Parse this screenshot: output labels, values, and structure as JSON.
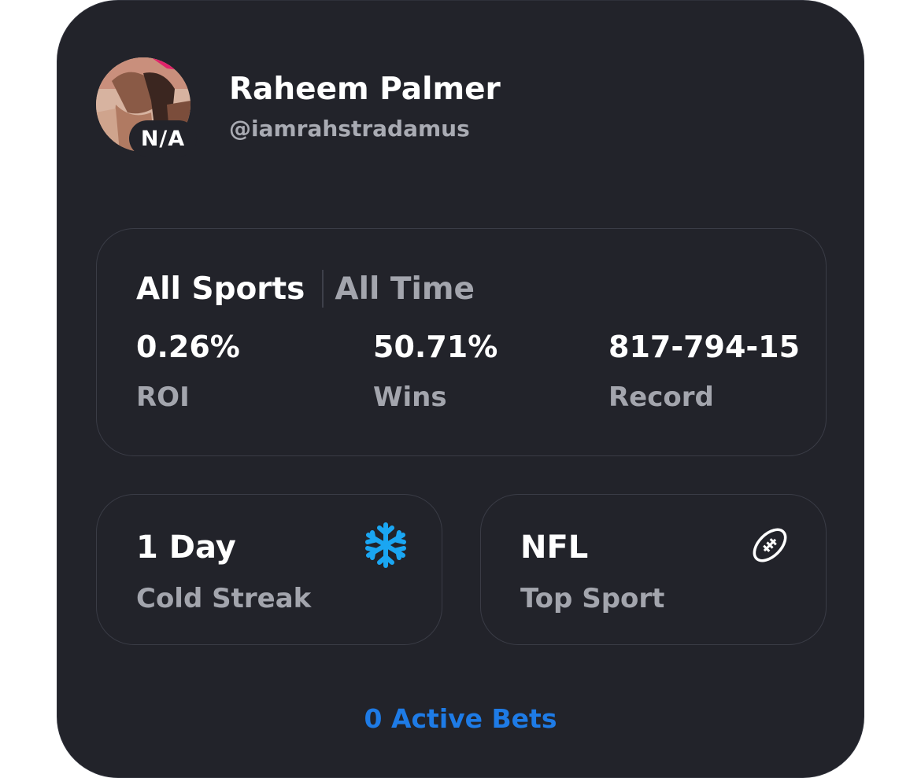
{
  "profile": {
    "name": "Raheem Palmer",
    "handle": "@iamrahstradamus",
    "rank_badge": "N/A"
  },
  "filters": {
    "sport": "All Sports",
    "time": "All Time"
  },
  "stats": {
    "roi": {
      "value": "0.26%",
      "label": "ROI"
    },
    "wins": {
      "value": "50.71%",
      "label": "Wins"
    },
    "record": {
      "value": "817-794-15",
      "label": "Record"
    }
  },
  "streak": {
    "value": "1 Day",
    "label": "Cold Streak",
    "icon": "snowflake-icon",
    "icon_color": "#1aa6f2"
  },
  "top_sport": {
    "value": "NFL",
    "label": "Top Sport",
    "icon": "football-icon"
  },
  "footer": {
    "active_bets": "0 Active Bets",
    "link_color": "#1e7be6"
  },
  "colors": {
    "card_background": "#22232a",
    "primary_text": "#ffffff",
    "secondary_text": "#a3a5ad",
    "panel_border": "#3a3c46"
  }
}
